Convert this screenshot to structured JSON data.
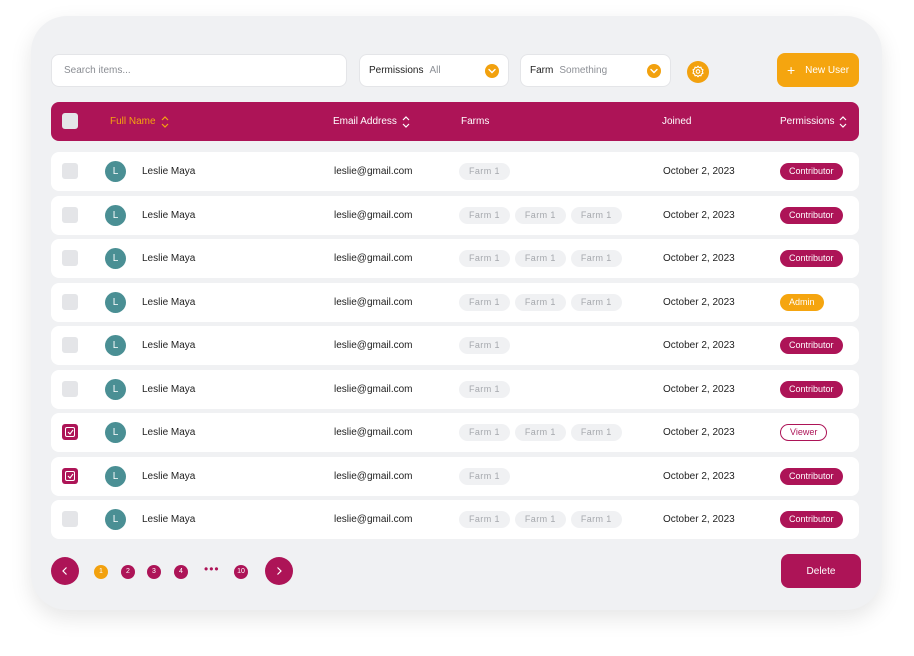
{
  "toolbar": {
    "search_placeholder": "Search items...",
    "permissions_filter": {
      "label": "Permissions",
      "value": "All"
    },
    "farm_filter": {
      "label": "Farm",
      "value": "Something"
    },
    "new_user_label": "New User"
  },
  "table": {
    "headers": {
      "full_name": "Full Name",
      "email": "Email Address",
      "farms": "Farms",
      "joined": "Joined",
      "permissions": "Permissions"
    },
    "rows": [
      {
        "initial": "L",
        "name": "Leslie Maya",
        "email": "leslie@gmail.com",
        "farms": [
          "Farm 1"
        ],
        "joined": "October 2, 2023",
        "permission": "Contributor",
        "checked": false
      },
      {
        "initial": "L",
        "name": "Leslie Maya",
        "email": "leslie@gmail.com",
        "farms": [
          "Farm 1",
          "Farm 1",
          "Farm 1"
        ],
        "joined": "October 2, 2023",
        "permission": "Contributor",
        "checked": false
      },
      {
        "initial": "L",
        "name": "Leslie Maya",
        "email": "leslie@gmail.com",
        "farms": [
          "Farm 1",
          "Farm 1",
          "Farm 1"
        ],
        "joined": "October 2, 2023",
        "permission": "Contributor",
        "checked": false
      },
      {
        "initial": "L",
        "name": "Leslie Maya",
        "email": "leslie@gmail.com",
        "farms": [
          "Farm 1",
          "Farm 1",
          "Farm 1"
        ],
        "joined": "October 2, 2023",
        "permission": "Admin",
        "checked": false
      },
      {
        "initial": "L",
        "name": "Leslie Maya",
        "email": "leslie@gmail.com",
        "farms": [
          "Farm 1"
        ],
        "joined": "October 2, 2023",
        "permission": "Contributor",
        "checked": false
      },
      {
        "initial": "L",
        "name": "Leslie Maya",
        "email": "leslie@gmail.com",
        "farms": [
          "Farm 1"
        ],
        "joined": "October 2, 2023",
        "permission": "Contributor",
        "checked": false
      },
      {
        "initial": "L",
        "name": "Leslie Maya",
        "email": "leslie@gmail.com",
        "farms": [
          "Farm 1",
          "Farm 1",
          "Farm 1"
        ],
        "joined": "October 2, 2023",
        "permission": "Viewer",
        "checked": true
      },
      {
        "initial": "L",
        "name": "Leslie Maya",
        "email": "leslie@gmail.com",
        "farms": [
          "Farm 1"
        ],
        "joined": "October 2, 2023",
        "permission": "Contributor",
        "checked": true
      },
      {
        "initial": "L",
        "name": "Leslie Maya",
        "email": "leslie@gmail.com",
        "farms": [
          "Farm 1",
          "Farm 1",
          "Farm 1"
        ],
        "joined": "October 2, 2023",
        "permission": "Contributor",
        "checked": false
      }
    ]
  },
  "pagination": {
    "pages": [
      "1",
      "2",
      "3",
      "4"
    ],
    "active_page": "1",
    "ellipsis": "•••",
    "last_page": "10"
  },
  "actions": {
    "delete_label": "Delete"
  },
  "colors": {
    "primary": "#ad1457",
    "accent": "#f5a50f",
    "avatar": "#4a8f94"
  },
  "icons": {
    "dropdown": "chevron-down-icon",
    "settings": "gear-icon",
    "sort": "sort-icon",
    "prev": "chevron-left-icon",
    "next": "chevron-right-icon"
  }
}
